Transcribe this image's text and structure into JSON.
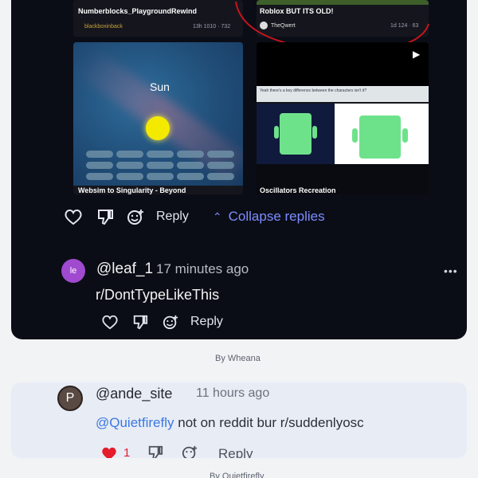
{
  "thumbnails": [
    {
      "title": "Numberblocks_PlaygroundRewind",
      "author": "blackboxinback",
      "stats": "13h 1010 · 732"
    },
    {
      "title": "Roblox BUT ITS OLD!",
      "author": "TheQwert",
      "stats": "1d 124 · 63"
    },
    {
      "title": "Websim to Singularity - Beyond",
      "overlay_label": "Sun"
    },
    {
      "title": "Oscillators Recreation",
      "banner": "Yeah there's a key difference between the characters isn't it?"
    }
  ],
  "thread_actions": {
    "reply": "Reply",
    "collapse": "Collapse replies"
  },
  "comment1": {
    "avatar": "le",
    "avatar_color": "#a04ad0",
    "username": "@leaf_1",
    "time": "17 minutes ago",
    "text": "r/DontTypeLikeThis",
    "reply": "Reply"
  },
  "credit1": "By Wheana",
  "comment2": {
    "avatar": "P",
    "username": "@ande_site",
    "time": "11 hours ago",
    "mention": "@Quietfirefly",
    "text": " not on reddit bur r/suddenlyosc",
    "likes": "1",
    "reply": "Reply"
  },
  "credit2": "By Quietfirefly",
  "colors": {
    "accent": "#7b8cff",
    "mention": "#3b78e0",
    "heart": "#e41c2c"
  }
}
